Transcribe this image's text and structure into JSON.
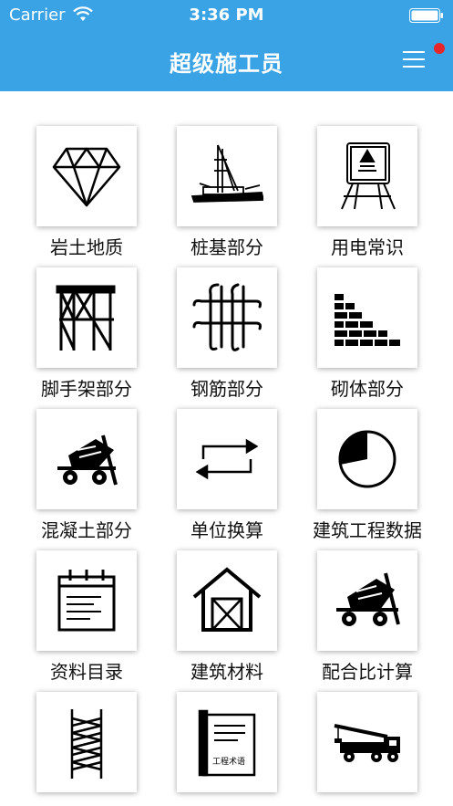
{
  "status": {
    "carrier": "Carrier",
    "time": "3:36 PM"
  },
  "header": {
    "title": "超级施工员"
  },
  "tiles": [
    {
      "label": "岩土地质",
      "icon": "diamond-icon"
    },
    {
      "label": "桩基部分",
      "icon": "pile-driver-icon"
    },
    {
      "label": "用电常识",
      "icon": "electrical-panel-icon"
    },
    {
      "label": "脚手架部分",
      "icon": "scaffold-icon"
    },
    {
      "label": "钢筋部分",
      "icon": "rebar-icon"
    },
    {
      "label": "砌体部分",
      "icon": "brick-wall-icon"
    },
    {
      "label": "混凝土部分",
      "icon": "concrete-mixer-icon"
    },
    {
      "label": "单位换算",
      "icon": "convert-arrows-icon"
    },
    {
      "label": "建筑工程数据",
      "icon": "pie-chart-icon"
    },
    {
      "label": "资料目录",
      "icon": "calendar-notes-icon"
    },
    {
      "label": "建筑材料",
      "icon": "house-frame-icon"
    },
    {
      "label": "配合比计算",
      "icon": "mixer-truck-icon"
    },
    {
      "label": "",
      "icon": "tower-crane-mast-icon"
    },
    {
      "label": "",
      "icon": "glossary-book-icon",
      "book_title": "工程术语"
    },
    {
      "label": "",
      "icon": "crane-truck-icon"
    }
  ]
}
